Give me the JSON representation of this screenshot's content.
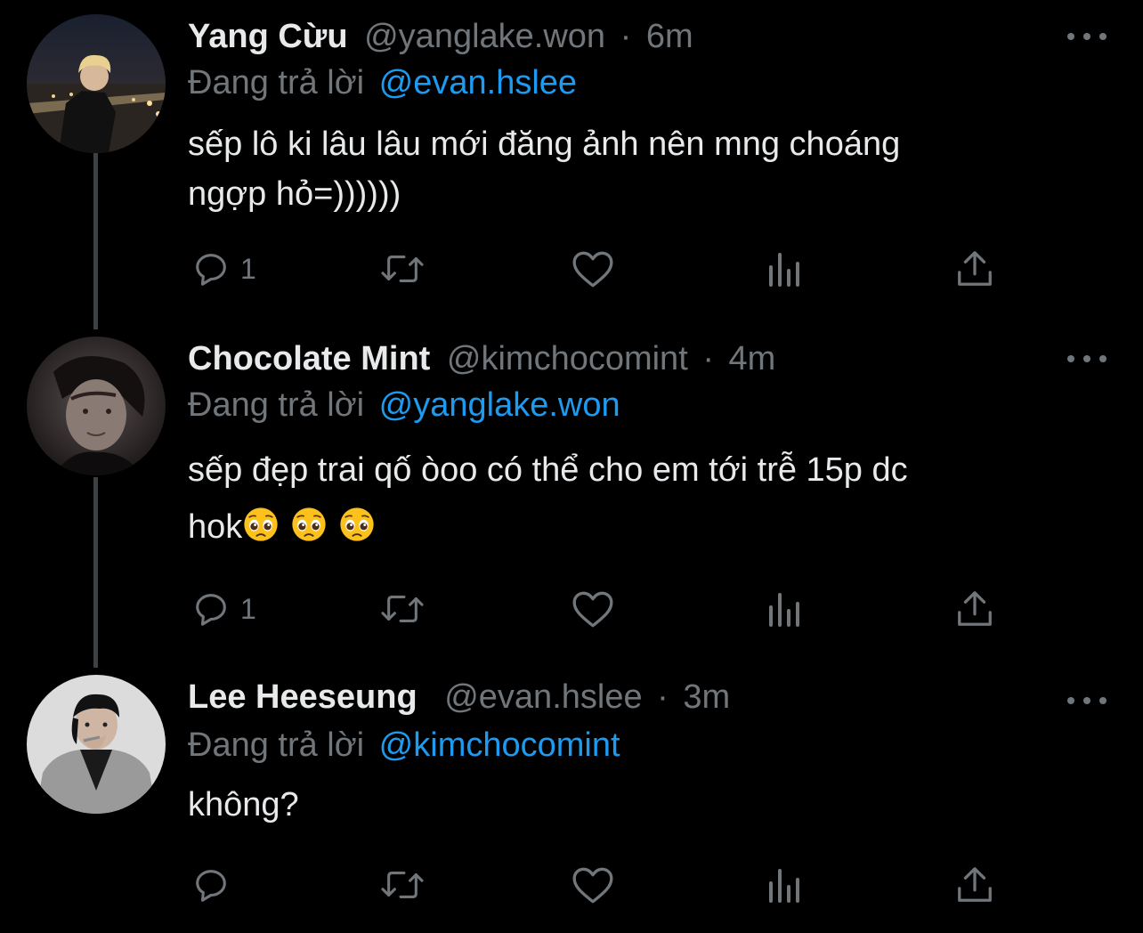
{
  "colors": {
    "background": "#000000",
    "primary_text": "#e7e9ea",
    "secondary_text": "#71767b",
    "link": "#1d9bf0",
    "thread_line": "#3e4144"
  },
  "tweets": [
    {
      "display_name": "Yang Cừu",
      "handle": "@yanglake.won",
      "separator": "·",
      "time": "6m",
      "reply_label": "Đang trả lời",
      "reply_to": "@evan.hslee",
      "text_line1": "sếp lô ki lâu lâu mới đăng ảnh nên mng choáng",
      "text_line2": "ngợp hỏ=))))))",
      "reply_count": "1",
      "icons": [
        "reply-icon",
        "retweet-icon",
        "like-icon",
        "views-icon",
        "share-icon",
        "more-icon"
      ]
    },
    {
      "display_name": "Chocolate Mint",
      "handle": "@kimchocomint",
      "separator": "·",
      "time": "4m",
      "reply_label": "Đang trả lời",
      "reply_to": "@yanglake.won",
      "text_line1": "sếp đẹp trai qố òoo có thể cho em tới trễ 15p dc",
      "text_line2": "hok",
      "emoji": "pleading-face-emoji x3",
      "reply_count": "1",
      "icons": [
        "reply-icon",
        "retweet-icon",
        "like-icon",
        "views-icon",
        "share-icon",
        "more-icon"
      ]
    },
    {
      "display_name": "Lee Heeseung",
      "handle": "@evan.hslee",
      "separator": "·",
      "time": "3m",
      "reply_label": "Đang trả lời",
      "reply_to": "@kimchocomint",
      "text_line1": "không?",
      "reply_count": "",
      "icons": [
        "reply-icon",
        "retweet-icon",
        "like-icon",
        "views-icon",
        "share-icon",
        "more-icon"
      ]
    }
  ]
}
